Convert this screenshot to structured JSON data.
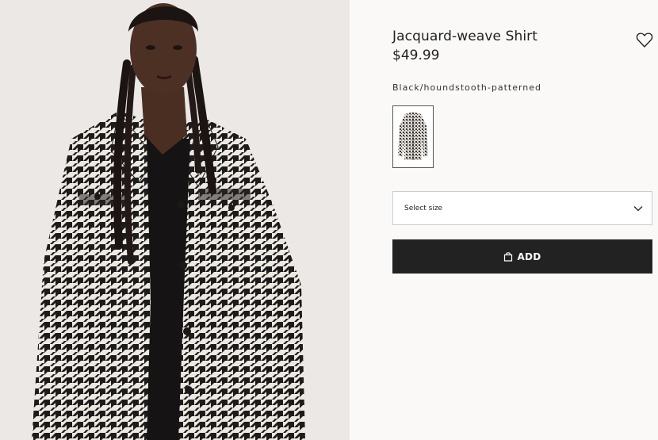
{
  "product": {
    "title": "Jacquard-weave Shirt",
    "price": "$49.99",
    "color_name": "Black/houndstooth-patterned"
  },
  "size_select": {
    "placeholder": "Select size"
  },
  "add_button": {
    "label": "ADD",
    "icon": "shopping-bag-icon"
  },
  "favorite": {
    "icon": "heart-icon"
  },
  "colors": {
    "button": "#222222",
    "page_background": "#faf9f8",
    "photo_background": "#ebe8e5"
  }
}
